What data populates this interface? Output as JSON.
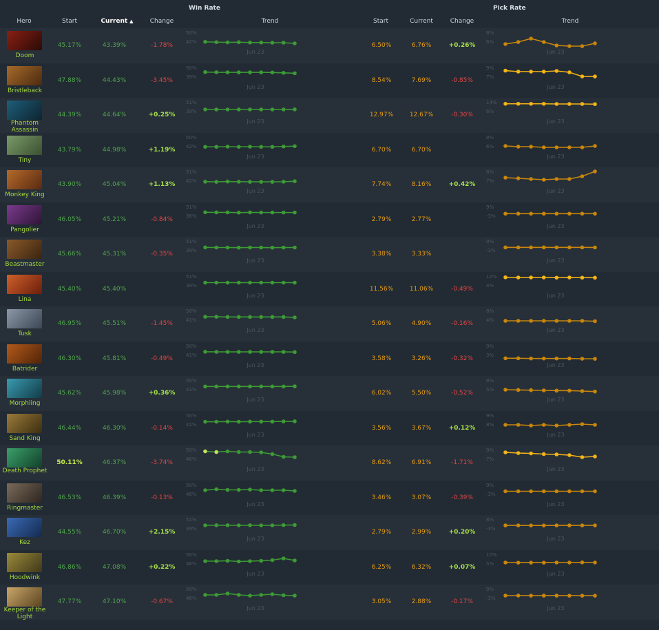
{
  "headers": {
    "hero": "Hero",
    "win_rate_title": "Win Rate",
    "pick_rate_title": "Pick Rate",
    "wr_start": "Start",
    "wr_current": "Current",
    "wr_change": "Change",
    "wr_trend": "Trend",
    "pr_start": "Start",
    "pr_current": "Current",
    "pr_change": "Change",
    "pr_trend": "Trend",
    "sort_icon": "sort-ascending-icon"
  },
  "trend_date": "Jun 23",
  "colors": {
    "win_line": "#3d9b35",
    "win_highlight": "#c6e35a",
    "pick_line": "#c9860c",
    "pick_highlight": "#f5b418"
  },
  "rows": [
    {
      "hero": "Doom",
      "wr_start": "45.17%",
      "wr_current": "43.39%",
      "wr_change": "-1.78%",
      "pr_start": "6.50%",
      "pr_current": "6.76%",
      "pr_change": "+0.26%",
      "wr_ticks": [
        "50%",
        "42%"
      ],
      "pr_ticks": [
        "8%",
        "6%"
      ],
      "wr_trend": [
        44.5,
        44.3,
        44.2,
        44.3,
        44.1,
        44.1,
        44.0,
        44.0,
        43.6
      ],
      "pr_trend": [
        6.3,
        6.6,
        7.1,
        6.6,
        6.1,
        5.9,
        5.8,
        6.4
      ]
    },
    {
      "hero": "Bristleback",
      "wr_start": "47.88%",
      "wr_current": "44.43%",
      "wr_change": "-3.45%",
      "pr_start": "8.54%",
      "pr_current": "7.69%",
      "pr_change": "-0.85%",
      "wr_ticks": [
        "50%",
        "39%"
      ],
      "pr_ticks": [
        "9%",
        "7%"
      ],
      "wr_trend": [
        46.3,
        46.2,
        46.1,
        46.1,
        46.1,
        46.1,
        46.0,
        45.7,
        45.4
      ],
      "pr_trend": [
        8.54,
        8.4,
        8.4,
        8.4,
        8.5,
        8.3,
        7.7,
        7.69
      ]
    },
    {
      "hero": "Phantom Assassin",
      "wr_start": "44.39%",
      "wr_current": "44.64%",
      "wr_change": "+0.25%",
      "pr_start": "12.97%",
      "pr_current": "12.67%",
      "pr_change": "-0.30%",
      "wr_ticks": [
        "51%",
        "39%"
      ],
      "pr_ticks": [
        "14%",
        "6%"
      ],
      "wr_trend": [
        44.4,
        44.4,
        44.4,
        44.4,
        44.4,
        44.4,
        44.4,
        44.4,
        44.5
      ],
      "pr_trend": [
        12.9,
        12.9,
        12.9,
        12.9,
        12.8,
        12.8,
        12.8,
        12.7
      ]
    },
    {
      "hero": "Tiny",
      "wr_start": "43.79%",
      "wr_current": "44.98%",
      "wr_change": "+1.19%",
      "pr_start": "6.70%",
      "pr_current": "6.70%",
      "pr_change": "",
      "wr_ticks": [
        "50%",
        "42%"
      ],
      "pr_ticks": [
        "8%",
        "6%"
      ],
      "wr_trend": [
        44.3,
        44.3,
        44.4,
        44.3,
        44.4,
        44.3,
        44.3,
        44.5,
        44.7
      ],
      "pr_trend": [
        6.7,
        6.6,
        6.6,
        6.5,
        6.5,
        6.5,
        6.5,
        6.7
      ]
    },
    {
      "hero": "Monkey King",
      "wr_start": "43.90%",
      "wr_current": "45.04%",
      "wr_change": "+1.13%",
      "pr_start": "7.74%",
      "pr_current": "8.16%",
      "pr_change": "+0.42%",
      "wr_ticks": [
        "51%",
        "42%"
      ],
      "pr_ticks": [
        "8%",
        "7%"
      ],
      "wr_trend": [
        44.3,
        44.2,
        44.4,
        44.3,
        44.2,
        44.2,
        44.2,
        44.3,
        44.6
      ],
      "pr_trend": [
        7.55,
        7.5,
        7.45,
        7.4,
        7.45,
        7.45,
        7.65,
        8.16
      ]
    },
    {
      "hero": "Pangolier",
      "wr_start": "46.05%",
      "wr_current": "45.21%",
      "wr_change": "-0.84%",
      "pr_start": "2.79%",
      "pr_current": "2.77%",
      "pr_change": "",
      "wr_ticks": [
        "51%",
        "38%"
      ],
      "pr_ticks": [
        "9%",
        "-3%"
      ],
      "wr_trend": [
        45.6,
        45.5,
        45.5,
        45.3,
        45.5,
        45.4,
        45.4,
        45.4,
        45.4
      ],
      "pr_trend": [
        2.8,
        2.8,
        2.8,
        2.8,
        2.8,
        2.8,
        2.8,
        2.77
      ]
    },
    {
      "hero": "Beastmaster",
      "wr_start": "45.66%",
      "wr_current": "45.31%",
      "wr_change": "-0.35%",
      "pr_start": "3.38%",
      "pr_current": "3.33%",
      "pr_change": "",
      "wr_ticks": [
        "51%",
        "39%"
      ],
      "pr_ticks": [
        "9%",
        "-3%"
      ],
      "wr_trend": [
        45.4,
        45.3,
        45.3,
        45.2,
        45.3,
        45.3,
        45.2,
        45.3,
        45.3
      ],
      "pr_trend": [
        3.4,
        3.4,
        3.4,
        3.4,
        3.4,
        3.4,
        3.4,
        3.33
      ]
    },
    {
      "hero": "Lina",
      "wr_start": "45.40%",
      "wr_current": "45.40%",
      "wr_change": "",
      "pr_start": "11.56%",
      "pr_current": "11.06%",
      "pr_change": "-0.49%",
      "wr_ticks": [
        "51%",
        "39%"
      ],
      "pr_ticks": [
        "12%",
        "4%"
      ],
      "wr_trend": [
        45.3,
        45.3,
        45.3,
        45.3,
        45.3,
        45.3,
        45.3,
        45.3,
        45.3
      ],
      "pr_trend": [
        11.3,
        11.2,
        11.2,
        11.2,
        11.1,
        11.2,
        11.1,
        11.06
      ]
    },
    {
      "hero": "Tusk",
      "wr_start": "46.95%",
      "wr_current": "45.51%",
      "wr_change": "-1.45%",
      "pr_start": "5.06%",
      "pr_current": "4.90%",
      "pr_change": "-0.16%",
      "wr_ticks": [
        "50%",
        "41%"
      ],
      "pr_ticks": [
        "8%",
        "4%"
      ],
      "wr_trend": [
        45.9,
        45.9,
        45.8,
        45.8,
        45.8,
        45.8,
        45.8,
        45.8,
        45.5
      ],
      "pr_trend": [
        5.0,
        5.0,
        5.0,
        5.0,
        5.0,
        5.0,
        5.0,
        4.9
      ]
    },
    {
      "hero": "Batrider",
      "wr_start": "46.30%",
      "wr_current": "45.81%",
      "wr_change": "-0.49%",
      "pr_start": "3.58%",
      "pr_current": "3.26%",
      "pr_change": "-0.32%",
      "wr_ticks": [
        "50%",
        "41%"
      ],
      "pr_ticks": [
        "9%",
        "3%"
      ],
      "wr_trend": [
        46.0,
        45.9,
        45.9,
        45.9,
        45.9,
        45.9,
        45.9,
        45.9,
        45.8
      ],
      "pr_trend": [
        3.5,
        3.5,
        3.4,
        3.4,
        3.4,
        3.4,
        3.3,
        3.26
      ]
    },
    {
      "hero": "Morphling",
      "wr_start": "45.62%",
      "wr_current": "45.98%",
      "wr_change": "+0.36%",
      "pr_start": "6.02%",
      "pr_current": "5.50%",
      "pr_change": "-0.52%",
      "wr_ticks": [
        "50%",
        "41%"
      ],
      "pr_ticks": [
        "8%",
        "5%"
      ],
      "wr_trend": [
        45.8,
        45.8,
        45.8,
        45.8,
        45.8,
        45.8,
        45.8,
        45.8,
        45.9
      ],
      "pr_trend": [
        5.9,
        5.85,
        5.8,
        5.75,
        5.7,
        5.7,
        5.6,
        5.5
      ]
    },
    {
      "hero": "Sand King",
      "wr_start": "46.44%",
      "wr_current": "46.30%",
      "wr_change": "-0.14%",
      "pr_start": "3.56%",
      "pr_current": "3.67%",
      "pr_change": "+0.12%",
      "wr_ticks": [
        "50%",
        "41%"
      ],
      "pr_ticks": [
        "9%",
        "8%"
      ],
      "wr_trend": [
        45.7,
        45.7,
        45.8,
        45.7,
        45.8,
        45.8,
        45.8,
        45.9,
        46.0
      ],
      "pr_trend": [
        8.3,
        8.3,
        8.25,
        8.3,
        8.25,
        8.3,
        8.35,
        8.3
      ]
    },
    {
      "hero": "Death Prophet",
      "wr_start": "50.11%",
      "wr_current": "46.37%",
      "wr_change": "-3.74%",
      "pr_start": "8.62%",
      "pr_current": "6.91%",
      "pr_change": "-1.71%",
      "wr_ticks": [
        "50%",
        "46%"
      ],
      "pr_ticks": [
        "9%",
        "7%"
      ],
      "wr_trend": [
        49.5,
        49.3,
        49.5,
        49.3,
        49.3,
        49.2,
        48.7,
        47.9,
        47.8
      ],
      "pr_trend": [
        8.6,
        8.5,
        8.45,
        8.35,
        8.3,
        8.2,
        7.9,
        8.0
      ]
    },
    {
      "hero": "Ringmaster",
      "wr_start": "46.53%",
      "wr_current": "46.39%",
      "wr_change": "-0.13%",
      "pr_start": "3.46%",
      "pr_current": "3.07%",
      "pr_change": "-0.39%",
      "wr_ticks": [
        "50%",
        "46%"
      ],
      "pr_ticks": [
        "9%",
        "-3%"
      ],
      "wr_trend": [
        48.4,
        48.7,
        48.5,
        48.5,
        48.6,
        48.4,
        48.4,
        48.4,
        48.2
      ],
      "pr_trend": [
        3.3,
        3.3,
        3.3,
        3.3,
        3.3,
        3.3,
        3.3,
        3.3
      ]
    },
    {
      "hero": "Kez",
      "wr_start": "44.55%",
      "wr_current": "46.70%",
      "wr_change": "+2.15%",
      "pr_start": "2.79%",
      "pr_current": "2.99%",
      "pr_change": "+0.20%",
      "wr_ticks": [
        "51%",
        "39%"
      ],
      "pr_ticks": [
        "8%",
        "-3%"
      ],
      "wr_trend": [
        45.6,
        45.7,
        45.7,
        45.6,
        45.7,
        45.6,
        45.6,
        45.8,
        45.9
      ],
      "pr_trend": [
        3.0,
        3.0,
        2.95,
        2.95,
        3.0,
        3.0,
        3.0,
        2.99
      ]
    },
    {
      "hero": "Hoodwink",
      "wr_start": "46.86%",
      "wr_current": "47.08%",
      "wr_change": "+0.22%",
      "pr_start": "6.25%",
      "pr_current": "6.32%",
      "pr_change": "+0.07%",
      "wr_ticks": [
        "50%",
        "46%"
      ],
      "pr_ticks": [
        "10%",
        "5%"
      ],
      "wr_trend": [
        48.0,
        48.0,
        48.1,
        47.9,
        48.0,
        48.1,
        48.3,
        48.8,
        48.2
      ],
      "pr_trend": [
        7.0,
        6.95,
        6.95,
        6.95,
        7.0,
        7.0,
        7.05,
        7.0
      ]
    },
    {
      "hero": "Keeper of the Light",
      "wr_start": "47.77%",
      "wr_current": "47.10%",
      "wr_change": "-0.67%",
      "pr_start": "3.05%",
      "pr_current": "2.88%",
      "pr_change": "-0.17%",
      "wr_ticks": [
        "50%",
        "46%"
      ],
      "pr_ticks": [
        "9%",
        "-3%"
      ],
      "wr_trend": [
        48.2,
        48.2,
        48.6,
        48.2,
        48.0,
        48.2,
        48.4,
        48.1,
        48.0
      ],
      "pr_trend": [
        3.0,
        3.0,
        2.95,
        2.95,
        2.95,
        2.9,
        2.9,
        2.88
      ]
    }
  ]
}
